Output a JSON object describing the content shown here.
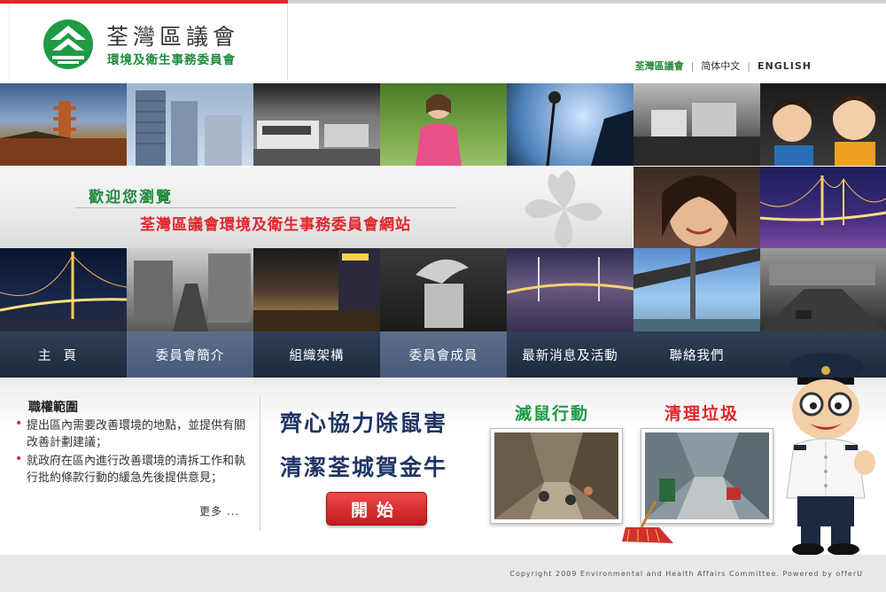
{
  "header": {
    "logo_title": "荃灣區議會",
    "logo_subtitle": "環境及衛生事務委員會"
  },
  "languages": [
    "荃灣區議會",
    "简体中文",
    "ENGLISH"
  ],
  "banner": {
    "welcome": "歡迎您瀏覽",
    "site_name": "荃灣區議會環境及衛生事務委員會網站"
  },
  "nav": [
    "主頁",
    "委員會簡介",
    "組織架構",
    "委員會成員",
    "最新消息及活動",
    "聯絡我們"
  ],
  "duties": {
    "title": "職權範圍",
    "items": [
      "提出區內需要改善環境的地點，並提供有關改善計劃建議；",
      "就政府在區內進行改善環境的清拆工作和執行批約條款行動的緩急先後提供意見；"
    ],
    "more": "更多 ..."
  },
  "promo": {
    "line1": "齊心協力除鼠害",
    "line2": "清潔荃城賀金牛",
    "start_button": "開始",
    "game1_title": "滅鼠行動",
    "game2_title": "清理垃圾"
  },
  "footer": {
    "copyright": "Copyright 2009 Environmental and Health Affairs Committee. Powered by offerU"
  },
  "colors": {
    "brand_green": "#1f8a3c",
    "accent_red": "#e0262b",
    "nav_dark": "#1d2a3c",
    "nav_light": "#4e6180"
  }
}
